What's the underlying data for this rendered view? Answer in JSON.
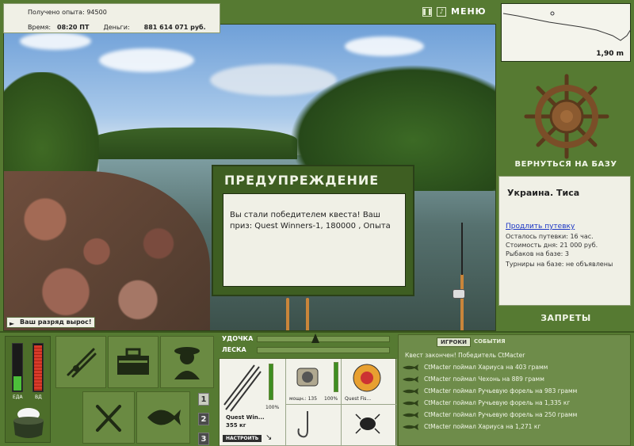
{
  "stats": {
    "exp_label": "Получено опыта:",
    "exp_value": "94500",
    "time_label": "Время:",
    "time_value": "08:20 ПТ",
    "money_label": "Деньги:",
    "money_value": "881 614 071 руб."
  },
  "top": {
    "menu_label": "МЕНЮ"
  },
  "depth": {
    "value": "1,90 m"
  },
  "base": {
    "return_label": "ВЕРНУТЬСЯ НА БАЗУ",
    "location": "Украина. Тиса",
    "extend_link": "Продлить путевку",
    "remaining": "Осталось путевки: 16 час.",
    "day_cost": "Стоимость дня: 21 000 руб.",
    "fishers": "Рыбаков на базе: 3",
    "tournaments": "Турниры на базе: не объявлены",
    "bans_label": "ЗАПРЕТЫ"
  },
  "popup": {
    "title": "ПРЕДУПРЕЖДЕНИЕ",
    "message": "Вы стали победителем квеста! Ваш приз: Quest Winners-1, 180000 , Опыта"
  },
  "toast": {
    "text": "Ваш разряд вырос!"
  },
  "needs": {
    "food_label": "ЕДА",
    "drink_label": "ВД",
    "food_level": 0.3,
    "drink_level": 0.95
  },
  "quickbar": {
    "slots": [
      "1",
      "2",
      "3"
    ]
  },
  "rig": {
    "rod_label": "УДОЧКА",
    "line_label": "ЛЕСКА",
    "rod_name": "Quest Win...",
    "rod_weight": "355 кг",
    "rod_pct": "100%",
    "reel_name": "мощн.: 135",
    "reel_pct": "100%",
    "line_name": "Quest Fis...",
    "hook_name": "",
    "bait_name": "",
    "setup_label": "НАСТРОИТЬ"
  },
  "events": {
    "tab_players": "ИГРОКИ",
    "tab_events": "СОБЫТИЯ",
    "header": "Квест закончен! Победитель CtMacter",
    "messages": [
      "CtMacter поймал Хариуса на 403 грамм",
      "CtMacter поймал Чехонь на 889 грамм",
      "CtMacter поймал Ручьевую форель на 983 грамм",
      "CtMacter поймал Ручьевую форель на 1,335 кг",
      "CtMacter поймал Ручьевую форель на 250 грамм",
      "CtMacter поймал Хариуса на 1,271 кг"
    ]
  }
}
